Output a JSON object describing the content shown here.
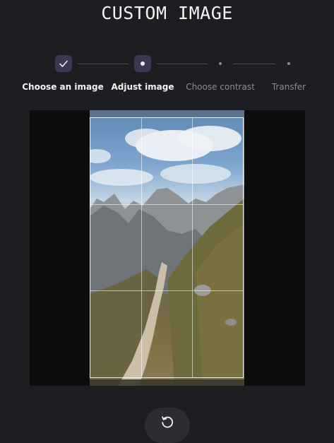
{
  "header": {
    "title": "CUSTOM IMAGE"
  },
  "stepper": {
    "steps": [
      {
        "label": "Choose an image",
        "state": "done"
      },
      {
        "label": "Adjust image",
        "state": "active"
      },
      {
        "label": "Choose contrast",
        "state": "pending"
      },
      {
        "label": "Transfer",
        "state": "pending"
      }
    ]
  },
  "editor": {
    "image": "mountain-trail-photo",
    "grid": "rule-of-thirds"
  },
  "controls": {
    "reset_icon": "rotate-ccw-icon"
  },
  "colors": {
    "background": "#1d1e21",
    "accent": "#3b3952",
    "canvas": "#0d0d0d"
  }
}
